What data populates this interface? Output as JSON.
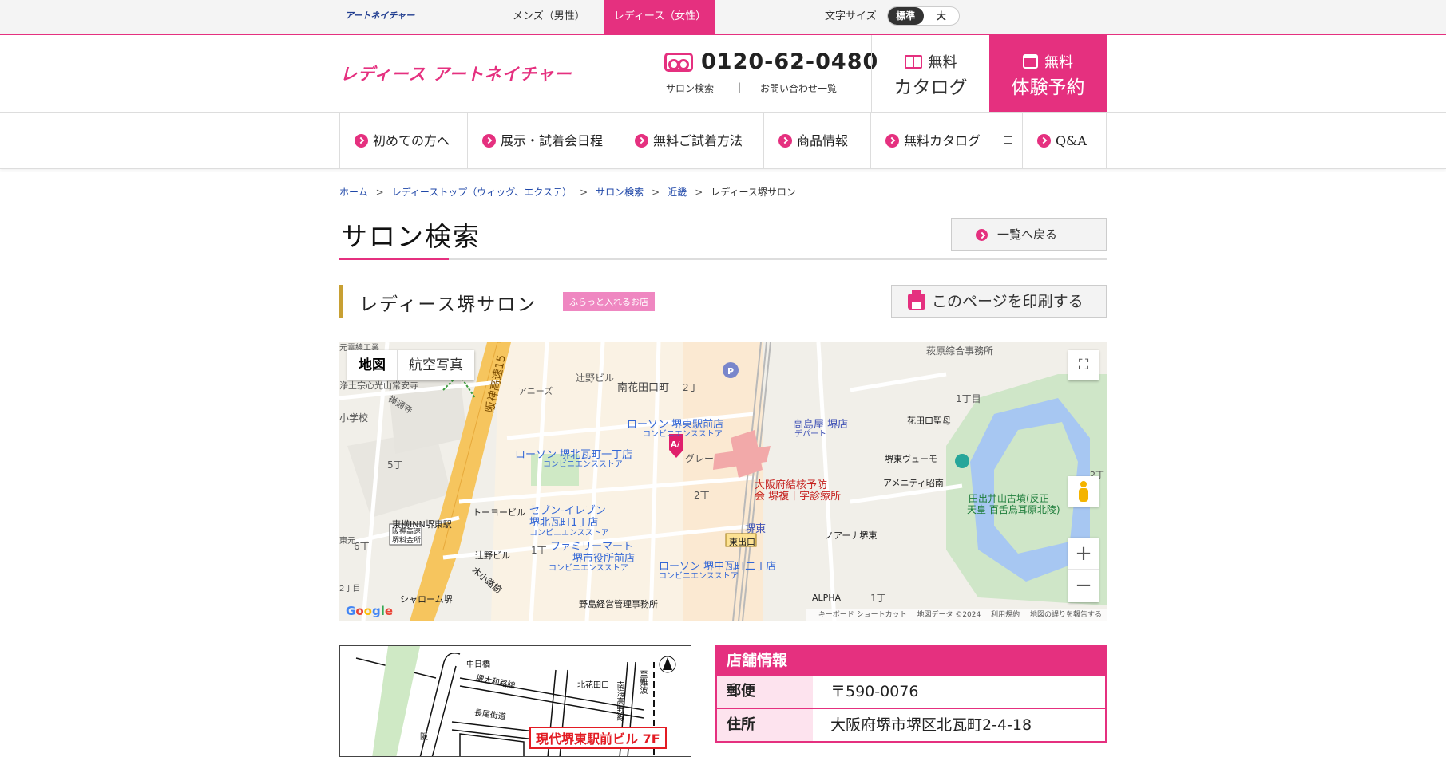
{
  "topbar": {
    "logo": "アートネイチャー",
    "men_tab": "メンズ（男性）",
    "women_tab": "レディース（女性）",
    "font_size_label": "文字サイズ",
    "font_size_standard": "標準",
    "font_size_large": "大"
  },
  "header": {
    "logo": "レディース アートネイチャー",
    "phone": "0120-62-0480",
    "link_salon_search": "サロン検索",
    "separator": "|",
    "link_contacts": "お問い合わせ一覧",
    "catalog_line1": "無料",
    "catalog_line2": "カタログ",
    "trial_line1": "無料",
    "trial_line2": "体験予約"
  },
  "nav": {
    "items": [
      "初めての方へ",
      "展示・試着会日程",
      "無料ご試着方法",
      "商品情報",
      "無料カタログ",
      "Q&A"
    ]
  },
  "breadcrumb": {
    "items": [
      "ホーム",
      "レディーストップ（ウィッグ、エクステ）",
      "サロン検索",
      "近畿"
    ],
    "current": "レディース堺サロン",
    "sep": ">"
  },
  "page": {
    "title": "サロン検索",
    "back_button": "一覧へ戻る",
    "salon_name": "レディース堺サロン",
    "salon_badge": "ふらっと入れるお店",
    "print_button": "このページを印刷する"
  },
  "map": {
    "tab_map": "地図",
    "tab_satellite": "航空写真",
    "fullscreen": "⛶",
    "zoom_in": "+",
    "zoom_out": "−",
    "google": [
      "G",
      "o",
      "o",
      "g",
      "l",
      "e"
    ],
    "attribution": [
      "キーボード ショートカット",
      "地図データ ©2024",
      "利用規約",
      "地図の誤りを報告する"
    ],
    "labels": {
      "l1": "萩原綜合事務所",
      "l2": "浄土宗心光山常安寺",
      "l3": "禅通寺",
      "l4": "辻野ビル",
      "l5": "アニーズ",
      "l6": "南花田口町",
      "l7": "2丁",
      "l8": "1丁目",
      "l9": "花田口聖母",
      "l10": "高島屋 堺店",
      "l11": "デパート",
      "l12": "ローソン 堺東駅前店",
      "l13": "コンビニエンスストア",
      "l14": "ローソン 堺北瓦町一丁店",
      "l15": "コンビニエンスストア",
      "l16": "グレー",
      "l17": "堺東ヴューモ",
      "l18": "アメニティ昭南",
      "l19": "大阪府結核予防",
      "l20": "会 堺複十字診療所",
      "l21": "5丁",
      "l22": "2丁",
      "l23": "トーヨービル",
      "l24": "セブン-イレブン",
      "l25": "堺北瓦町1丁店",
      "l26": "コンビニエンスストア",
      "l27": "東横INN堺東駅",
      "l28": "堺東",
      "l29": "ノアーナ堺東",
      "l30": "6丁",
      "l31": "辻野ビル",
      "l32": "1丁",
      "l33": "ファミリーマート",
      "l34": "堺市役所前店",
      "l35": "コンビニエンスストア",
      "l36": "ローソン 堺中瓦町二丁店",
      "l37": "コンビニエンスストア",
      "l38": "東出口",
      "l39": "木小路筋",
      "l40": "シャローム堺",
      "l41": "野島経営管理事務所",
      "l42": "ALPHA",
      "l43": "1丁",
      "l44": "田出井山古墳(反正",
      "l45": "天皇 百舌鳥耳原北陵)",
      "l46": "2丁",
      "l47": "阪神高速15",
      "l48": "小学校",
      "l49": "阪神高速",
      "l50": "堺料金所",
      "l51": "元電線工業",
      "l52": "2丁目",
      "l53": "東元"
    }
  },
  "access_map": {
    "labels": [
      "中日橋",
      "堺大和路線",
      "北花田口",
      "至難波",
      "南海高野線",
      "長尾街道",
      "阪"
    ],
    "building": "現代堺東駅前ビル 7F"
  },
  "store_info": {
    "heading": "店舗情報",
    "rows": [
      {
        "label": "郵便",
        "value": "〒590-0076"
      },
      {
        "label": "住所",
        "value": "大阪府堺市堺区北瓦町2-4-18"
      }
    ]
  },
  "colors": {
    "accent": "#e5307f",
    "salon_bar": "#c8a033",
    "badge": "#ef87c1",
    "link": "#1f47a8"
  }
}
